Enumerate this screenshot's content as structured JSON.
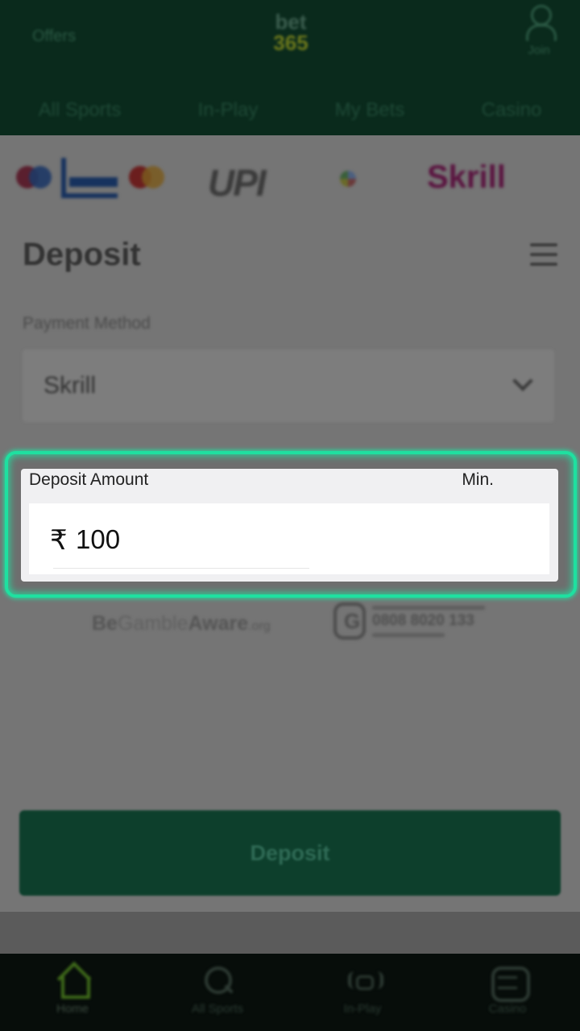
{
  "header": {
    "offers_label": "Offers",
    "logo_line1": "bet",
    "logo_line2": "365",
    "account_label": "Join",
    "nav": [
      "All Sports",
      "In-Play",
      "My Bets",
      "Casino"
    ]
  },
  "payment_logos": [
    "maestro",
    "visa",
    "mastercard",
    "UPI",
    "gpay",
    "Skrill"
  ],
  "payment_logo_text": {
    "upi": "UPI",
    "skrill": "Skrill"
  },
  "deposit": {
    "title": "Deposit",
    "payment_method_label": "Payment Method",
    "payment_method_value": "Skrill",
    "amount_label": "Deposit Amount",
    "amount_min_label": "Min.",
    "currency_symbol": "₹",
    "amount_value": "100",
    "button_label": "Deposit"
  },
  "responsible": {
    "be": "Be",
    "gamble": "Gamble",
    "aware": "Aware",
    "org": ".org",
    "phone": "0808 8020 133"
  },
  "bottom_nav": [
    {
      "label": "Home",
      "icon": "home-icon"
    },
    {
      "label": "All Sports",
      "icon": "search-icon"
    },
    {
      "label": "In-Play",
      "icon": "in-play-icon"
    },
    {
      "label": "Casino",
      "icon": "casino-icon"
    }
  ],
  "colors": {
    "highlight": "#1fe0a0",
    "brand_dark": "#0a2a1c",
    "button": "#0d3f2c"
  }
}
